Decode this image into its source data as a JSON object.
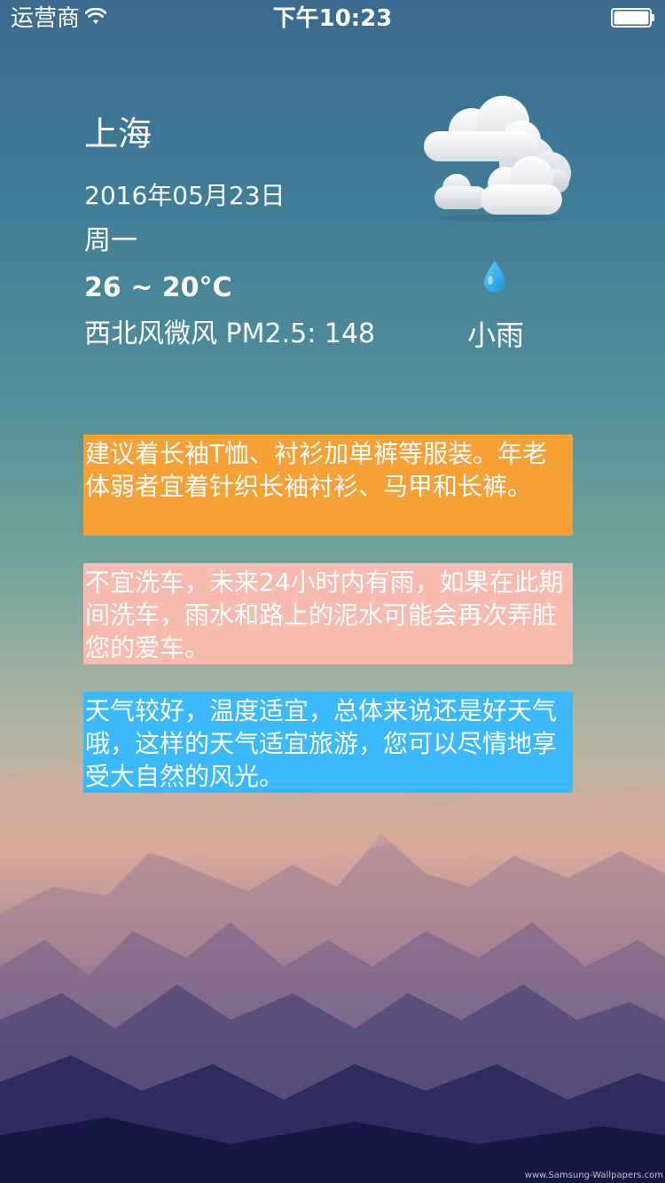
{
  "status_bar": {
    "carrier": "运营商",
    "time": "下午10:23"
  },
  "weather": {
    "city": "上海",
    "date": "2016年05月23日",
    "weekday": "周一",
    "temperature": "26 ~ 20°C",
    "wind_pm": "西北风微风 PM2.5: 148",
    "condition": "小雨",
    "icon": "cloudy-icon",
    "drop_icon": "raindrop-icon"
  },
  "suggestions": [
    {
      "text": "建议着长袖T恤、衬衫加单裤等服装。年老体弱者宜着针织长袖衬衫、马甲和长裤。",
      "color": "#f7a035"
    },
    {
      "text": "不宜洗车，未来24小时内有雨，如果在此期间洗车，雨水和路上的泥水可能会再次弄脏您的爱车。",
      "color": "#f9bab0"
    },
    {
      "text": "天气较好，温度适宜，总体来说还是好天气哦，这样的天气适宜旅游，您可以尽情地享受大自然的风光。",
      "color": "#3bb9ff"
    }
  ],
  "background": {
    "credit": "www.Samsung-Wallpapers.com"
  }
}
